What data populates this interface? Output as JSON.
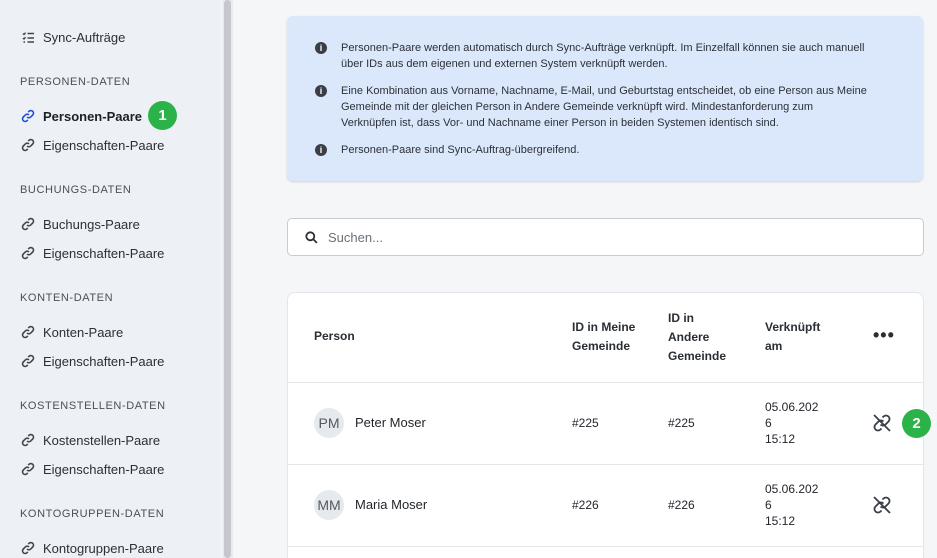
{
  "sidebar": {
    "sync_jobs": "Sync-Aufträge",
    "sections": {
      "personen": "PERSONEN-DATEN",
      "buchungen": "BUCHUNGS-DATEN",
      "konten": "KONTEN-DATEN",
      "kostenstellen": "KOSTENSTELLEN-DATEN",
      "kontogruppen": "KONTOGRUPPEN-DATEN"
    },
    "items": {
      "personen_paare": "Personen-Paare",
      "personen_eigenschaften": "Eigenschaften-Paare",
      "buchungs_paare": "Buchungs-Paare",
      "buchungs_eigenschaften": "Eigenschaften-Paare",
      "konten_paare": "Konten-Paare",
      "konten_eigenschaften": "Eigenschaften-Paare",
      "kostenstellen_paare": "Kostenstellen-Paare",
      "kostenstellen_eigenschaften": "Eigenschaften-Paare",
      "kontogruppen_paare": "Kontogruppen-Paare"
    }
  },
  "badges": {
    "one": "1",
    "two": "2"
  },
  "info": {
    "line1a": "Personen-Paare werden automatisch durch Sync-Aufträge verknüpft. Im Einzelfall können sie auch manuell",
    "line1b": "über IDs aus dem eigenen und externen System verknüpft werden.",
    "line2a": "Eine Kombination aus Vorname, Nachname, E-Mail, und Geburtstag entscheidet, ob eine Person aus Meine",
    "line2b": "Gemeinde mit der gleichen Person in Andere Gemeinde verknüpft wird. Mindestanforderung zum",
    "line2c": "Verknüpfen ist, dass Vor- und Nachname einer Person in beiden Systemen identisch sind.",
    "line3": "Personen-Paare sind Sync-Auftrag-übergreifend."
  },
  "search": {
    "placeholder": "Suchen..."
  },
  "table": {
    "headers": {
      "person": "Person",
      "id_meine_1": "ID in Meine",
      "id_meine_2": "Gemeinde",
      "id_andere_1": "ID in",
      "id_andere_2": "Andere",
      "id_andere_3": "Gemeinde",
      "verknuepft_1": "Verknüpft",
      "verknuepft_2": "am",
      "more": "•••"
    },
    "rows": [
      {
        "initials": "PM",
        "name": "Peter Moser",
        "id_meine": "#225",
        "id_andere": "#225",
        "date_1": "05.06.202",
        "date_2": "6",
        "time": "15:12"
      },
      {
        "initials": "MM",
        "name": "Maria Moser",
        "id_meine": "#226",
        "id_andere": "#226",
        "date_1": "05.06.202",
        "date_2": "6",
        "time": "15:12"
      }
    ]
  },
  "colors": {
    "accent": "#1f4ed8",
    "badge": "#2bb34a",
    "info_bg": "#dbe7fb"
  }
}
